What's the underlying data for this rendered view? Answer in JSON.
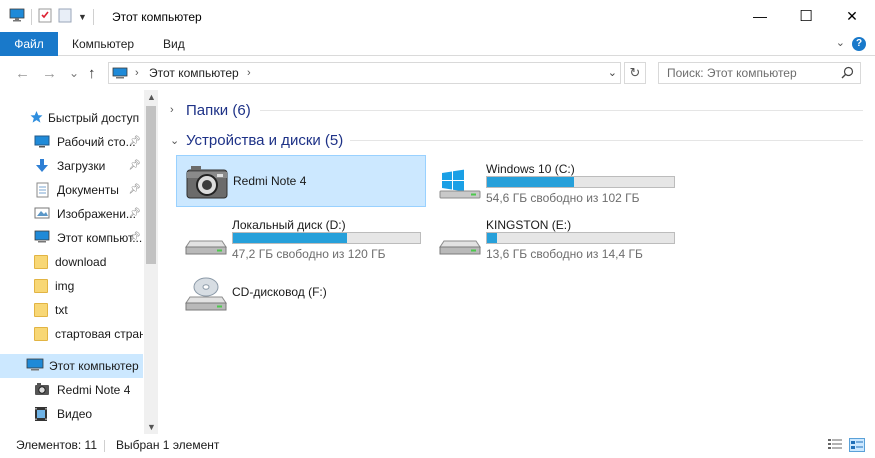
{
  "window": {
    "title": "Этот компьютер",
    "minimize": "—",
    "maximize": "☐",
    "close": "✕"
  },
  "ribbon": {
    "tabs": [
      "Файл",
      "Компьютер",
      "Вид"
    ],
    "help": "?"
  },
  "nav": {
    "back": "←",
    "forward": "→",
    "recent": "⌄",
    "up": "↑",
    "address_crumb": "Этот компьютер",
    "refresh": "↻",
    "search_placeholder": "Поиск: Этот компьютер"
  },
  "sidebar": {
    "items": [
      {
        "label": "Быстрый доступ",
        "icon": "star-icon"
      },
      {
        "label": "Рабочий сто...",
        "icon": "desktop-icon",
        "pinned": true
      },
      {
        "label": "Загрузки",
        "icon": "downloads-icon",
        "pinned": true
      },
      {
        "label": "Документы",
        "icon": "documents-icon",
        "pinned": true
      },
      {
        "label": "Изображени...",
        "icon": "pictures-icon",
        "pinned": true
      },
      {
        "label": "Этот компьют...",
        "icon": "computer-icon",
        "pinned": true
      },
      {
        "label": "download",
        "icon": "folder-icon"
      },
      {
        "label": "img",
        "icon": "folder-icon"
      },
      {
        "label": "txt",
        "icon": "folder-icon"
      },
      {
        "label": "стартовая стран...",
        "icon": "folder-icon"
      },
      {
        "label": "Этот компьютер",
        "icon": "computer-icon",
        "selected": true
      },
      {
        "label": "Redmi Note 4",
        "icon": "camera-icon"
      },
      {
        "label": "Видео",
        "icon": "video-icon"
      }
    ]
  },
  "content": {
    "groups": [
      {
        "title": "Папки (6)",
        "expanded": false
      },
      {
        "title": "Устройства и диски (5)",
        "expanded": true
      }
    ],
    "devices": [
      {
        "name": "Redmi Note 4",
        "icon": "camera-device-icon",
        "selected": true
      },
      {
        "name": "Windows 10 (C:)",
        "icon": "windows-drive-icon",
        "free_text": "54,6 ГБ свободно из 102 ГБ",
        "used_fraction": 0.465
      },
      {
        "name": "Локальный диск (D:)",
        "icon": "hard-drive-icon",
        "free_text": "47,2 ГБ свободно из 120 ГБ",
        "used_fraction": 0.607
      },
      {
        "name": "KINGSTON (E:)",
        "icon": "hard-drive-icon",
        "free_text": "13,6 ГБ свободно из 14,4 ГБ",
        "used_fraction": 0.056
      },
      {
        "name": "CD-дисковод (F:)",
        "icon": "cd-drive-icon"
      }
    ]
  },
  "status": {
    "count": "Элементов: 11",
    "selection": "Выбран 1 элемент"
  },
  "colors": {
    "accent": "#1979ca",
    "selection": "#cce8ff",
    "bar_fill": "#26a0da",
    "group_header": "#1e3287"
  }
}
